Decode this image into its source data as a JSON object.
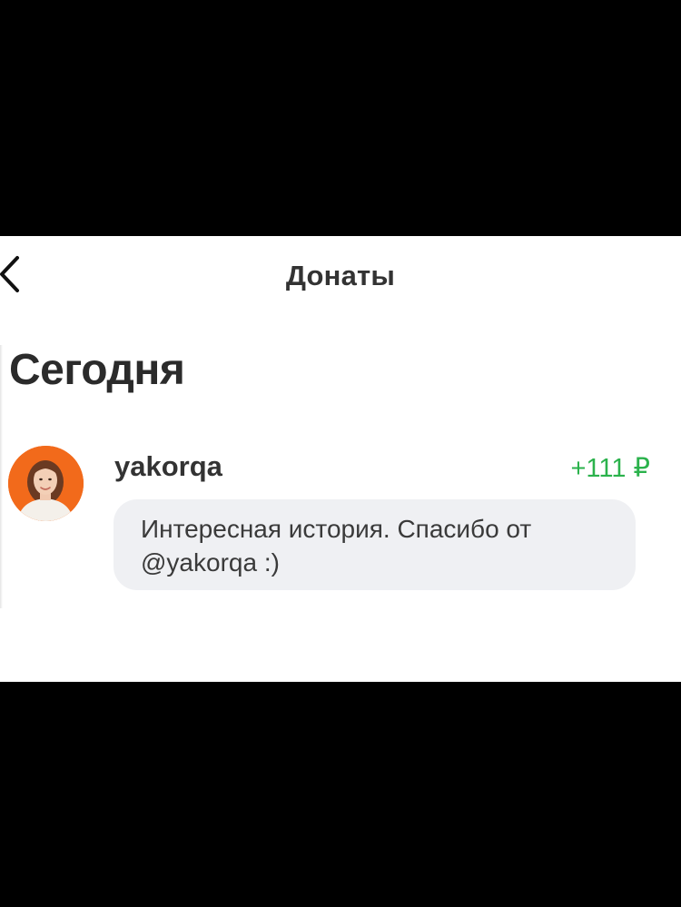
{
  "header": {
    "title": "Донаты",
    "back_icon": "chevron-left-icon"
  },
  "section": {
    "title": "Сегодня"
  },
  "donations": [
    {
      "username": "yakorqa",
      "amount": "+111 ₽",
      "amount_color": "#2bb24c",
      "avatar_bg": "#f26a1b",
      "message": "Интересная история. Спасибо от @yakorqa :)"
    }
  ],
  "colors": {
    "text": "#333333",
    "accent_positive": "#2bb24c",
    "bubble_bg": "#eff0f3"
  }
}
